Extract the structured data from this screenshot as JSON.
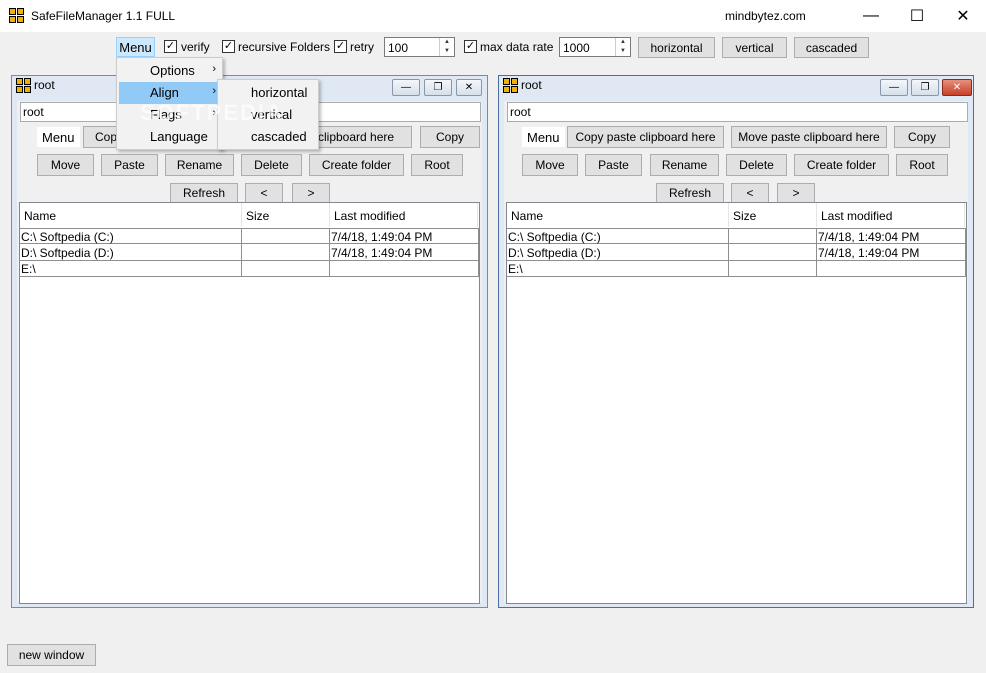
{
  "app": {
    "title": "SafeFileManager 1.1 FULL",
    "website": "mindbytez.com"
  },
  "toolbar": {
    "menu_label": "Menu",
    "verify_label": "verify",
    "recursive_label": "recursive Folders",
    "retry_label": "retry",
    "retry_value": "100",
    "maxrate_label": "max data rate",
    "maxrate_value": "1000",
    "horizontal_label": "horizontal",
    "vertical_label": "vertical",
    "cascaded_label": "cascaded"
  },
  "menu": {
    "items": [
      "Options",
      "Align",
      "Flags",
      "Language"
    ],
    "align_submenu": [
      "horizontal",
      "vertical",
      "cascaded"
    ]
  },
  "panel": {
    "title": "root",
    "path": "root",
    "menu_label": "Menu",
    "copy_paste_label": "Copy paste clipboard here",
    "copy_paste_partial": "clipboard here",
    "copy_partial": "Copy",
    "move_paste_label": "Move paste clipboard here",
    "copy_label": "Copy",
    "move_label": "Move",
    "paste_label": "Paste",
    "rename_label": "Rename",
    "delete_label": "Delete",
    "create_folder_label": "Create folder",
    "root_label": "Root",
    "refresh_label": "Refresh",
    "back_label": "<",
    "forward_label": ">",
    "columns": [
      "Name",
      "Size",
      "Last modified"
    ],
    "rows": [
      [
        "C:\\ Softpedia (C:)",
        "",
        "7/4/18,  1:49:04 PM"
      ],
      [
        "D:\\ Softpedia (D:)",
        "",
        "7/4/18,  1:49:04 PM"
      ],
      [
        "E:\\",
        "",
        ""
      ]
    ]
  },
  "bottom": {
    "new_window_label": "new window"
  },
  "watermark": "SOFTPEDIA"
}
